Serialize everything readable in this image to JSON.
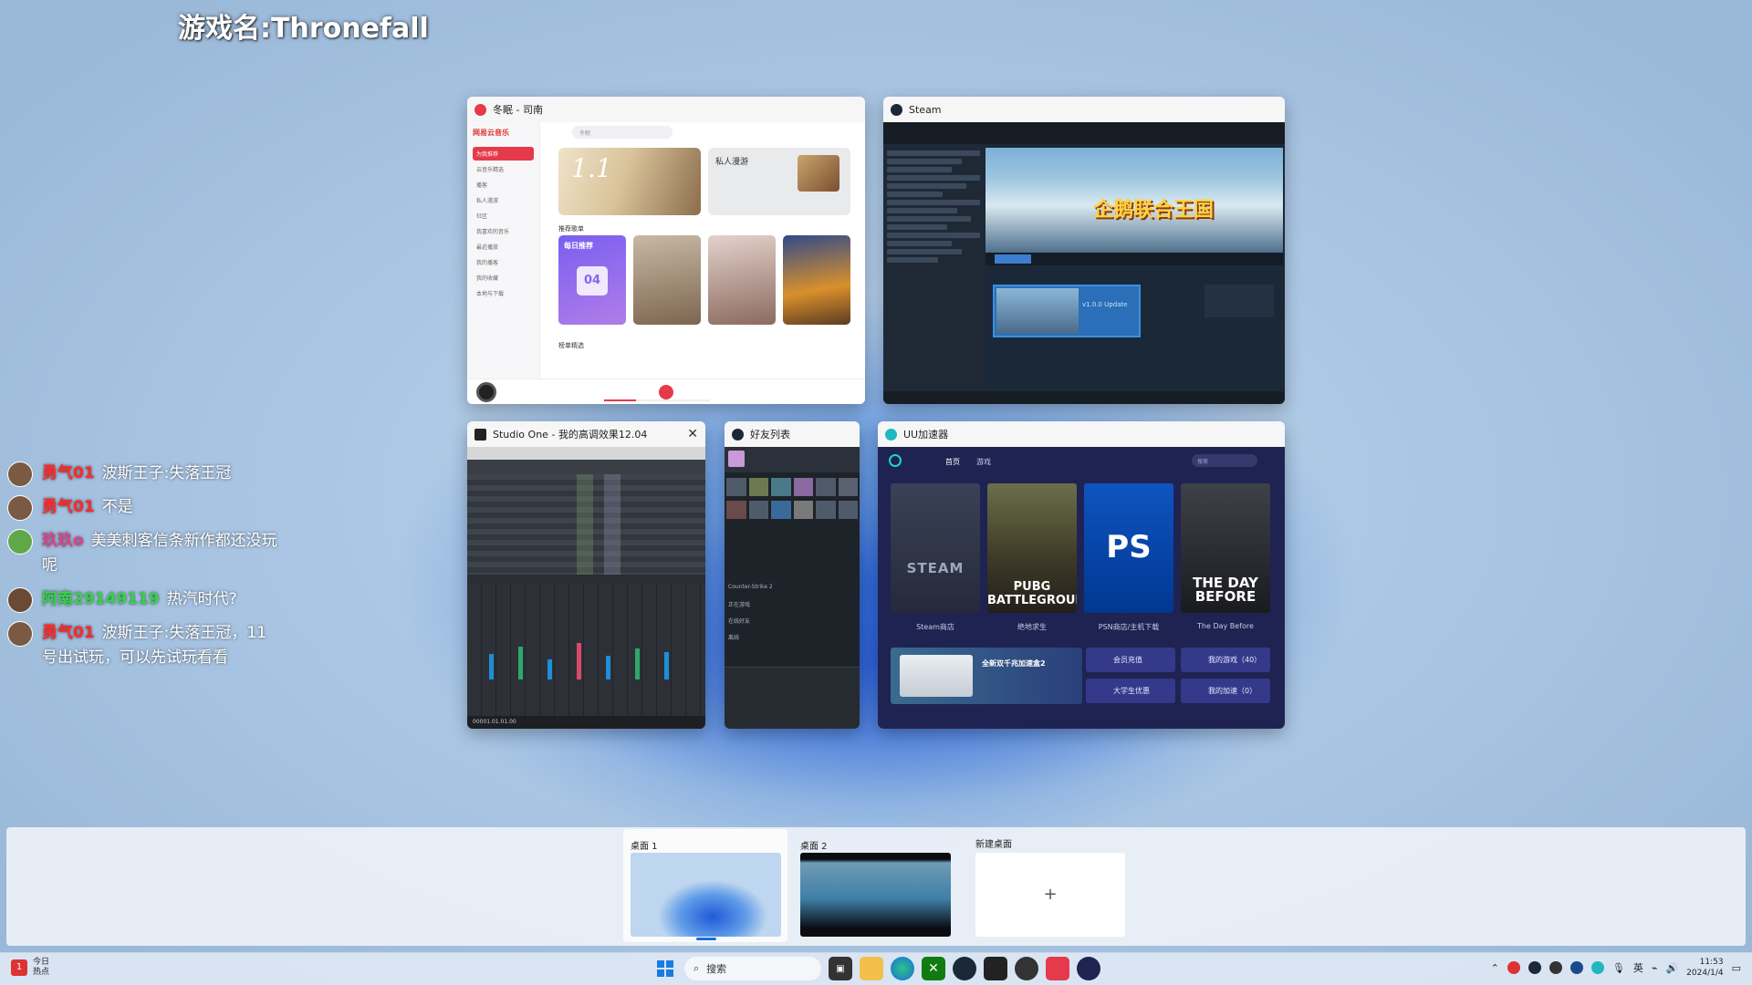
{
  "overlay": {
    "game_title": "游戏名:Thronefall"
  },
  "windows": {
    "music": {
      "title": "冬眠 - 司南",
      "brand": "网易云音乐",
      "search_placeholder": "冬眠",
      "nav": [
        "为我推荐",
        "云音乐精选",
        "播客",
        "私人漫游",
        "社区",
        "我喜欢的音乐",
        "最近播放",
        "我的播客",
        "我的收藏",
        "本地与下载"
      ],
      "banner_text": "1.1",
      "fm_title": "私人漫游",
      "section_recommended": "推荐歌单",
      "section_lower": "榜单精选",
      "daily_card": "每日推荐",
      "daily_date": "04"
    },
    "steam": {
      "title": "Steam",
      "game_logo": "企鹅联合王国",
      "news_caption": "v1.0.0 Update"
    },
    "studio_one": {
      "title": "Studio One - 我的高调效果12.04",
      "timecode": "00001.01.01.00"
    },
    "friends": {
      "title": "好友列表",
      "items": [
        "Counter-Strike 2",
        "正在游戏",
        "在线好友",
        "离线"
      ]
    },
    "uu": {
      "title": "UU加速器",
      "tabs": [
        "首页",
        "游戏"
      ],
      "search_placeholder": "搜索",
      "games": [
        {
          "card": "STEAM",
          "caption": "Steam商店"
        },
        {
          "card": "PUBG BATTLEGROUNDS",
          "caption": "绝地求生"
        },
        {
          "card": "PS",
          "caption": "PSN商店/主机下载"
        },
        {
          "card": "THE DAY BEFORE",
          "caption": "The Day Before"
        }
      ],
      "promo": "全新双千兆加速盒2",
      "buttons": [
        "会员充值",
        "我的游戏（40）",
        "大学生优惠",
        "我的加速（0）"
      ]
    }
  },
  "chat": [
    {
      "user": "勇气01",
      "text": "波斯王子:失落王冠"
    },
    {
      "user": "勇气01",
      "text": "不是"
    },
    {
      "user": "玖玖o",
      "text": "美美刺客信条新作都还没玩呢"
    },
    {
      "user": "阿南29149119",
      "text": "热汽时代?"
    },
    {
      "user": "勇气01",
      "text": "波斯王子:失落王冠，11号出试玩，可以先试玩看看"
    }
  ],
  "desktops": {
    "items": [
      {
        "label": "桌面 1"
      },
      {
        "label": "桌面 2"
      }
    ],
    "new_label": "新建桌面",
    "new_plus": "+"
  },
  "taskbar": {
    "weather_line1": "今日",
    "weather_line2": "热点",
    "search_placeholder": "搜索",
    "lang": "英",
    "time": "11:53",
    "date": "2024/1/4"
  },
  "colors": {
    "music_accent": "#e53a4b",
    "uu_bg": "#1f2352",
    "steam_bg": "#1b2838",
    "chat_user_red": "#ff2a2a",
    "chat_user_pink": "#e0408c",
    "chat_user_green": "#35d44a"
  }
}
